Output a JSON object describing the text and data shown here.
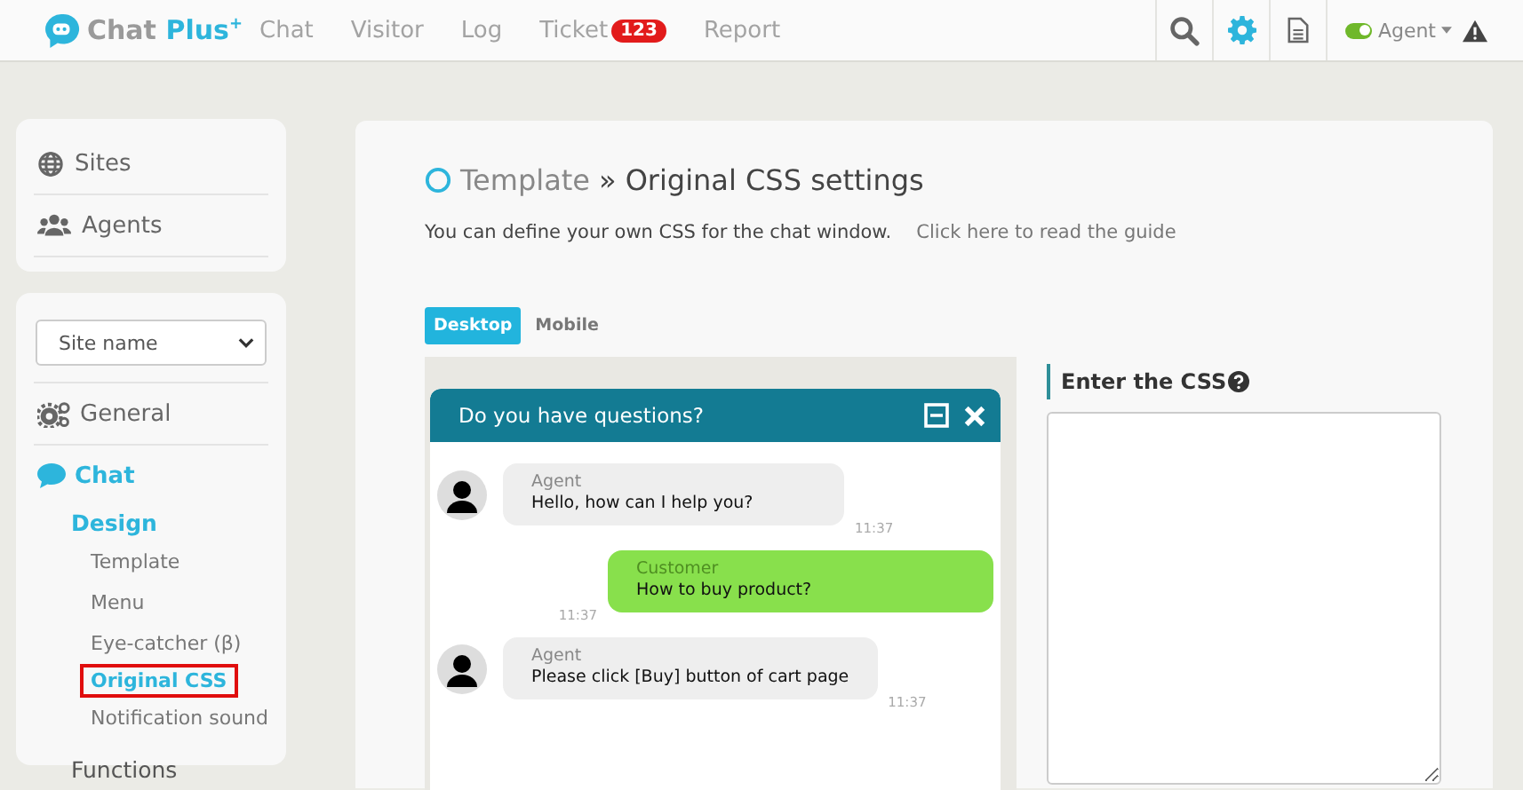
{
  "header": {
    "logo": {
      "word": "Chat",
      "accent": "Plus",
      "mark": "+"
    },
    "nav": [
      {
        "label": "Chat",
        "selected": false
      },
      {
        "label": "Visitor",
        "selected": false
      },
      {
        "label": "Log",
        "selected": false
      },
      {
        "label": "Ticket",
        "selected": false,
        "badge": "123"
      },
      {
        "label": "Report",
        "selected": false
      }
    ],
    "tools": [
      {
        "kind": "search",
        "selected": false
      },
      {
        "kind": "settings",
        "selected": true
      },
      {
        "kind": "document",
        "selected": false
      }
    ],
    "status": {
      "label": "Agent",
      "on": true
    }
  },
  "sidebar": {
    "top_items": [
      {
        "kind": "sites",
        "label": "Sites"
      },
      {
        "kind": "agents",
        "label": "Agents"
      }
    ],
    "site_select": {
      "value": "Site name"
    },
    "sections": [
      {
        "kind": "general",
        "label": "General",
        "selected": false
      },
      {
        "kind": "chat",
        "label": "Chat",
        "selected": true,
        "groups": [
          {
            "label": "Design",
            "selected": true,
            "items": [
              {
                "label": "Template",
                "selected": false
              },
              {
                "label": "Menu",
                "selected": false
              },
              {
                "label": "Eye-catcher (β)",
                "selected": false
              },
              {
                "label": "Original CSS",
                "selected": true
              },
              {
                "label": "Notification sound",
                "selected": false
              }
            ]
          },
          {
            "label": "Functions",
            "selected": false
          }
        ]
      }
    ]
  },
  "main": {
    "breadcrumb": {
      "parent": "Template",
      "separator": "»",
      "current": "Original CSS settings"
    },
    "description": "You can define your own CSS for the chat window.",
    "guide_link": "Click here to read the guide",
    "tabs": [
      {
        "label": "Desktop",
        "selected": true
      },
      {
        "label": "Mobile",
        "selected": false
      }
    ],
    "preview": {
      "title": "Do you have questions?",
      "messages": [
        {
          "kind": "agent",
          "sender": "Agent",
          "text": "Hello, how can I help you?",
          "time": "11:37"
        },
        {
          "kind": "customer",
          "sender": "Customer",
          "text": "How to buy product?",
          "time": "11:37"
        },
        {
          "kind": "agent",
          "sender": "Agent",
          "text": "Please click [Buy] button of cart page",
          "time": "11:37"
        }
      ]
    },
    "css_editor": {
      "label": "Enter the CSS"
    }
  }
}
